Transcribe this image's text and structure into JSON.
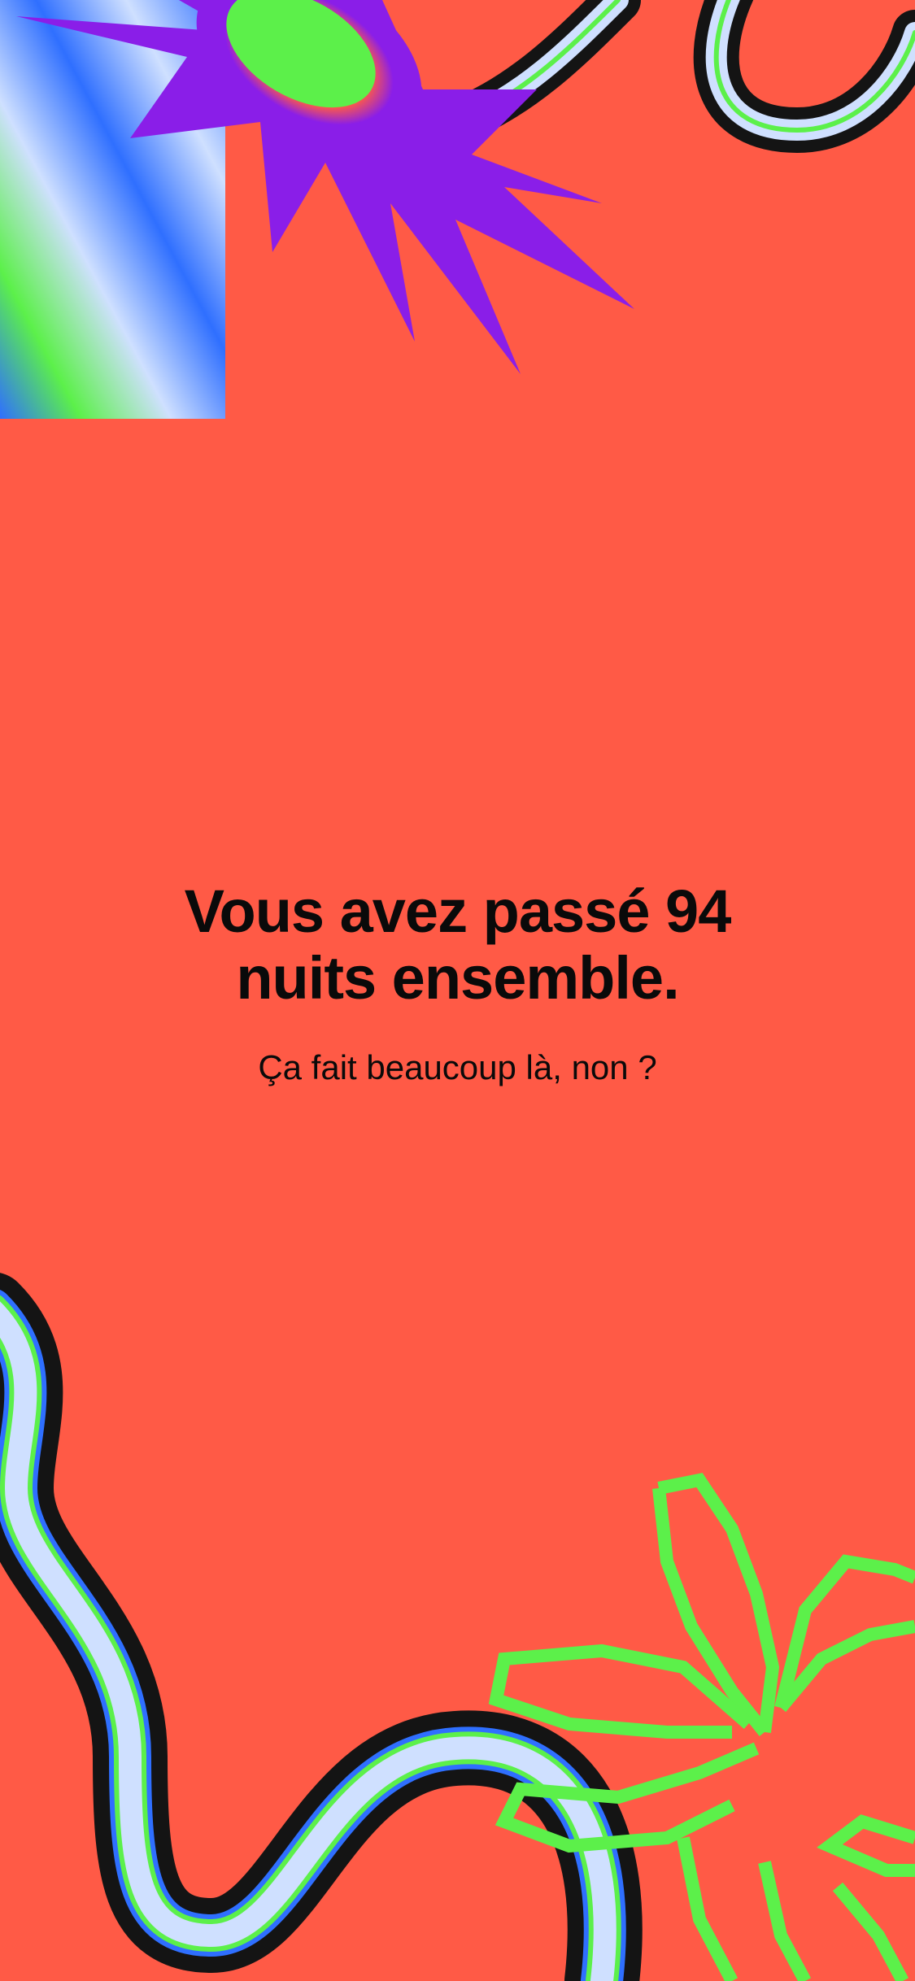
{
  "story": {
    "headline": "Vous avez passé 94 nuits ensemble.",
    "subline": "Ça fait beaucoup là, non ?"
  },
  "colors": {
    "background": "#ff5a46",
    "text": "#0a0a0a",
    "neon_green": "#5cf04a",
    "purple": "#8a1ee8",
    "blue": "#2f6fff",
    "pale_blue": "#cfe0ff",
    "black": "#141414"
  },
  "decorations": [
    "gradient-square-art",
    "spiky-star-art",
    "wavy-ribbon-art",
    "pixel-flower-art"
  ]
}
